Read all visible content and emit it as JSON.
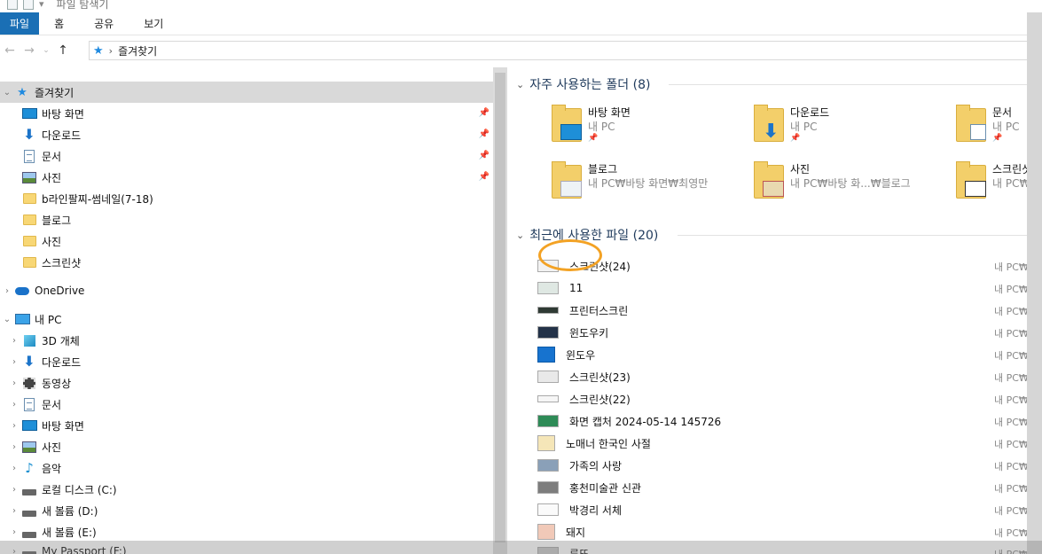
{
  "titlebar": {
    "title": "파일 탐색기"
  },
  "ribbon": {
    "tabs": [
      "파일",
      "홈",
      "공유",
      "보기"
    ]
  },
  "address": {
    "path": "즐겨찾기"
  },
  "nav": {
    "quick_access": "즐겨찾기",
    "pinned": [
      "바탕 화면",
      "다운로드",
      "문서",
      "사진"
    ],
    "recent": [
      "b라인팔찌-썸네일(7-18)",
      "블로그",
      "사진",
      "스크린샷"
    ],
    "onedrive": "OneDrive",
    "this_pc": "내 PC",
    "pc_items": [
      "3D 개체",
      "다운로드",
      "동영상",
      "문서",
      "바탕 화면",
      "사진",
      "음악",
      "로컬 디스크 (C:)",
      "새 볼륨 (D:)",
      "새 볼륨 (E:)",
      "My Passport (F:)"
    ]
  },
  "frequent": {
    "header": "자주 사용하는 폴더 (8)",
    "tiles": [
      {
        "name": "바탕 화면",
        "sub": "내 PC"
      },
      {
        "name": "다운로드",
        "sub": "내 PC"
      },
      {
        "name": "문서",
        "sub": "내 PC"
      },
      {
        "name": "블로그",
        "sub": "내 PC₩바탕 화면₩최영만"
      },
      {
        "name": "사진",
        "sub": "내 PC₩바탕 화...₩블로그"
      },
      {
        "name": "스크린샷",
        "sub": "내 PC₩사진"
      }
    ]
  },
  "recent_files": {
    "header": "최근에 사용한 파일 (20)",
    "items": [
      {
        "name": "스크린샷(24)",
        "loc": "내 PC₩바"
      },
      {
        "name": "11",
        "loc": "내 PC₩바"
      },
      {
        "name": "프린터스크린",
        "loc": "내 PC₩바"
      },
      {
        "name": "윈도우키",
        "loc": "내 PC₩바"
      },
      {
        "name": "윈도우",
        "loc": "내 PC₩바"
      },
      {
        "name": "스크린샷(23)",
        "loc": "내 PC₩바"
      },
      {
        "name": "스크린샷(22)",
        "loc": "내 PC₩바"
      },
      {
        "name": "화면 캡처 2024-05-14 145726",
        "loc": "내 PC₩바"
      },
      {
        "name": "노매너 한국인 사절",
        "loc": "내 PC₩바"
      },
      {
        "name": "가족의 사랑",
        "loc": "내 PC₩바"
      },
      {
        "name": "홍천미술관 신관",
        "loc": "내 PC₩바"
      },
      {
        "name": "박경리 서체",
        "loc": "내 PC₩바"
      },
      {
        "name": "돼지",
        "loc": "내 PC₩바"
      },
      {
        "name": "루또",
        "loc": "내 PC₩바"
      }
    ]
  },
  "colors": {
    "accent": "#1a6fb5",
    "annotation": "#f3a224",
    "selected": "#d9d9d9"
  }
}
